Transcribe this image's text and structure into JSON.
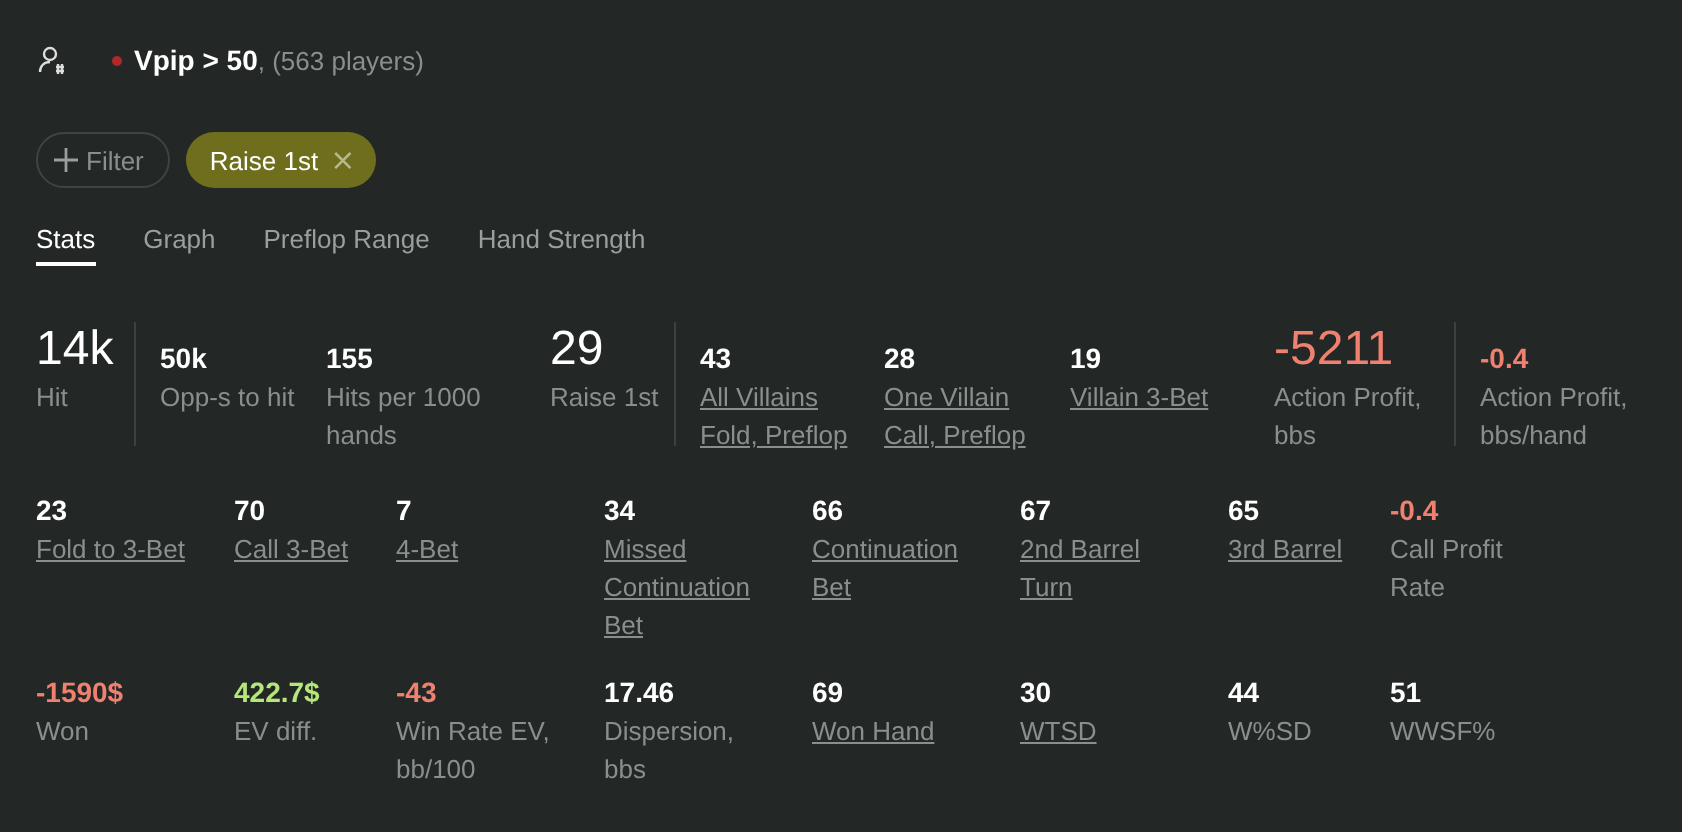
{
  "header": {
    "title": "Vpip > 50",
    "count": ", (563 players)"
  },
  "filters": [
    {
      "kind": "add",
      "label": "Filter"
    },
    {
      "kind": "chip",
      "label": "Raise 1st",
      "close": "×"
    }
  ],
  "tabs": [
    {
      "label": "Stats",
      "selected": true
    },
    {
      "label": "Graph",
      "selected": false
    },
    {
      "label": "Preflop Range",
      "selected": false
    },
    {
      "label": "Hand Strength",
      "selected": false
    }
  ],
  "summary_groups": [
    {
      "items": [
        {
          "value": "14k",
          "label": "Hit",
          "kind": "major",
          "color": "#ffffff",
          "link": false
        }
      ]
    },
    {
      "items": [
        {
          "value": "50k",
          "label": "Opp-s to hit",
          "kind": "minor",
          "color": "#ffffff",
          "link": false
        },
        {
          "value": "155",
          "label": "Hits per 1000 hands",
          "kind": "minor",
          "color": "#ffffff",
          "link": false
        },
        {
          "value": "29",
          "label": "Raise 1st",
          "kind": "major",
          "color": "#ffffff",
          "link": false
        }
      ]
    },
    {
      "items": [
        {
          "value": "43",
          "label": "All Villains Fold, Preflop",
          "kind": "minor",
          "color": "#ffffff",
          "link": true
        },
        {
          "value": "28",
          "label": "One Villain Call, Preflop",
          "kind": "minor",
          "color": "#ffffff",
          "link": true
        },
        {
          "value": "19",
          "label": "Villain 3-Bet",
          "kind": "minor",
          "color": "#ffffff",
          "link": true
        },
        {
          "value": "-5211",
          "label": "Action Profit, bbs",
          "kind": "major",
          "color": "#f08070",
          "link": false
        }
      ]
    },
    {
      "items": [
        {
          "value": "-0.4",
          "label": "Action Profit, bbs/hand",
          "kind": "minor",
          "color": "#f08070",
          "link": false
        }
      ]
    }
  ],
  "stats": [
    {
      "value": "23",
      "label": "Fold to 3-Bet",
      "color": "#ffffff",
      "link": true
    },
    {
      "value": "70",
      "label": "Call 3-Bet",
      "color": "#ffffff",
      "link": true
    },
    {
      "value": "7",
      "label": "4-Bet",
      "color": "#ffffff",
      "link": true
    },
    {
      "value": "34",
      "label": "Missed Continuation Bet",
      "color": "#ffffff",
      "link": true
    },
    {
      "value": "66",
      "label": "Continuation Bet",
      "color": "#ffffff",
      "link": true
    },
    {
      "value": "67",
      "label": "2nd Barrel Turn",
      "color": "#ffffff",
      "link": true
    },
    {
      "value": "65",
      "label": "3rd Barrel",
      "color": "#ffffff",
      "link": true
    },
    {
      "value": "-0.4",
      "label": "Call Profit Rate",
      "color": "#f08070",
      "link": false
    },
    {
      "value": "-1590$",
      "label": "Won",
      "color": "#f08070",
      "link": false
    },
    {
      "value": "422.7$",
      "label": "EV diff.",
      "color": "#b5e67a",
      "link": false
    },
    {
      "value": "-43",
      "label": "Win Rate EV, bb/100",
      "color": "#f08070",
      "link": false
    },
    {
      "value": "17.46",
      "label": "Dispersion, bbs",
      "color": "#ffffff",
      "link": false
    },
    {
      "value": "69",
      "label": "Won Hand",
      "color": "#ffffff",
      "link": true
    },
    {
      "value": "30",
      "label": "WTSD",
      "color": "#ffffff",
      "link": true
    },
    {
      "value": "44",
      "label": "W%SD",
      "color": "#ffffff",
      "link": false
    },
    {
      "value": "51",
      "label": "WWSF%",
      "color": "#ffffff",
      "link": false
    }
  ]
}
